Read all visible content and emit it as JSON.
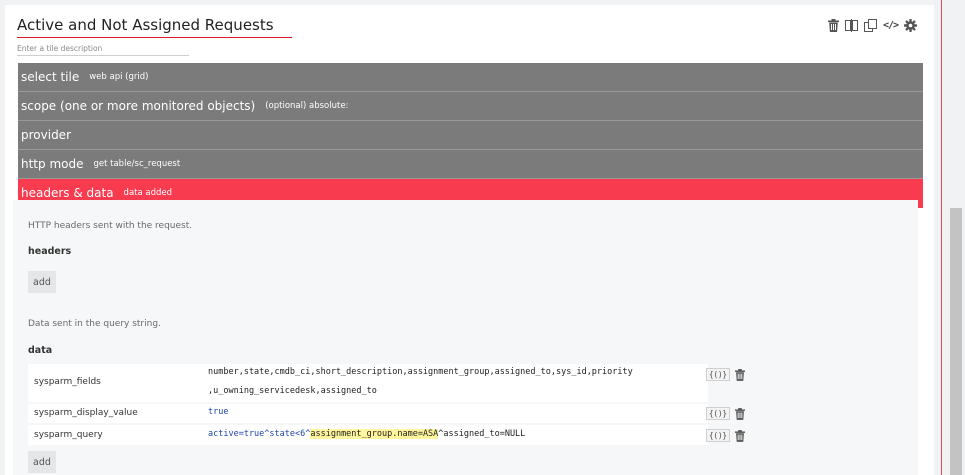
{
  "tile": {
    "title": "Active and Not Assigned Requests",
    "description_placeholder": "Enter a tile description"
  },
  "toolbar": {
    "icons": [
      "trash-icon",
      "split-icon",
      "copy-icon",
      "code-icon",
      "gear-icon"
    ],
    "code_glyph": "</>"
  },
  "sections": [
    {
      "label": "select tile",
      "sub": "web api (grid)"
    },
    {
      "label": "scope (one or more monitored objects)",
      "sub": "(optional) absolute:"
    },
    {
      "label": "provider",
      "sub": ""
    },
    {
      "label": "http mode",
      "sub": "get table/sc_request"
    },
    {
      "label": "headers & data",
      "sub": "data added"
    }
  ],
  "content": {
    "headers_note": "HTTP headers sent with the request.",
    "headers_title": "headers",
    "add_label": "add",
    "data_note": "Data sent in the query string.",
    "data_title": "data",
    "braces_label": "{()}",
    "rows": [
      {
        "key": "sysparm_fields",
        "value_line1": "number,state,cmdb_ci,short_description,assignment_group,assigned_to,sys_id,priority",
        "value_line2": ",u_owning_servicedesk,assigned_to"
      },
      {
        "key": "sysparm_display_value",
        "value": "true"
      },
      {
        "key": "sysparm_query",
        "value_pre": "active=true^state<6^",
        "value_highlight": "assignment_group.name=ASA",
        "value_post": "^assigned_to=NULL"
      }
    ]
  },
  "colors": {
    "accent": "#f93b50",
    "section_bg": "#7b7b7b",
    "highlight": "#fff59d"
  }
}
